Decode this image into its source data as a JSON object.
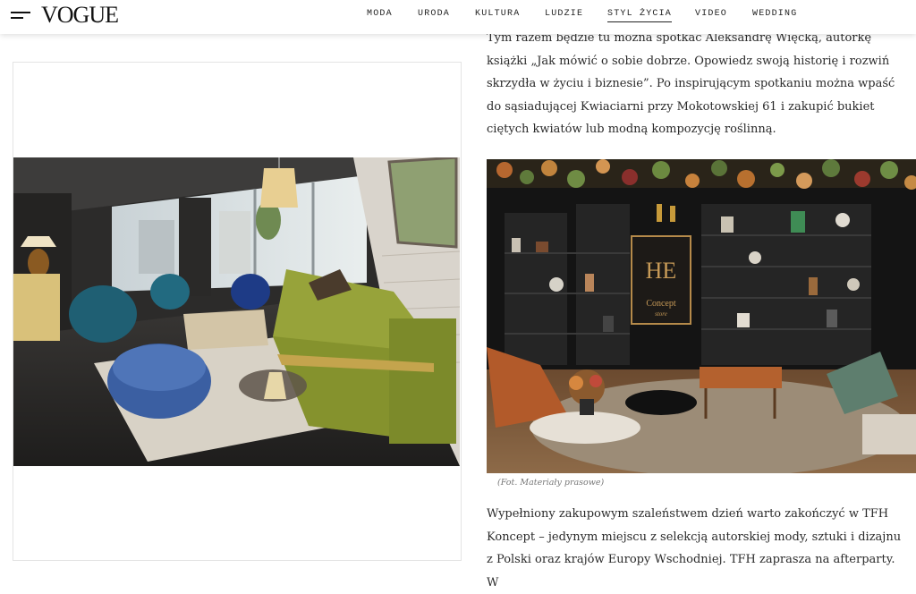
{
  "header": {
    "logo": "VOGUE",
    "nav": [
      "MODA",
      "URODA",
      "KULTURA",
      "LUDZIE",
      "STYL ŻYCIA",
      "VIDEO",
      "WEDDING"
    ],
    "active_nav": "STYL ŻYCIA"
  },
  "article": {
    "paragraph1": "Tym razem będzie tu można spotkać Aleksandrę Więcką, autorkę książki „Jak mówić o sobie dobrze. Opowiedz swoją historię i rozwiń skrzydła w życiu i biznesie”. Po inspirującym spotkaniu można wpaść do sąsiadującej Kwiaciarni przy Mokotowskiej 61 i zakupić bukiet ciętych kwiatów lub modną kompozycję roślinną.",
    "photo_caption": "(Fot. Materiały prasowe)",
    "paragraph2": "Wypełniony zakupowym szaleństwem dzień warto zakończyć w TFH Koncept – jedynym miejscu z selekcją autorskiej mody, sztuki i dizajnu z Polski oraz krajów Europy Wschodniej. TFH zaprasza na afterparty. W"
  },
  "store_sign": {
    "monogram": "HE",
    "line1": "Concept",
    "line2": "store"
  }
}
